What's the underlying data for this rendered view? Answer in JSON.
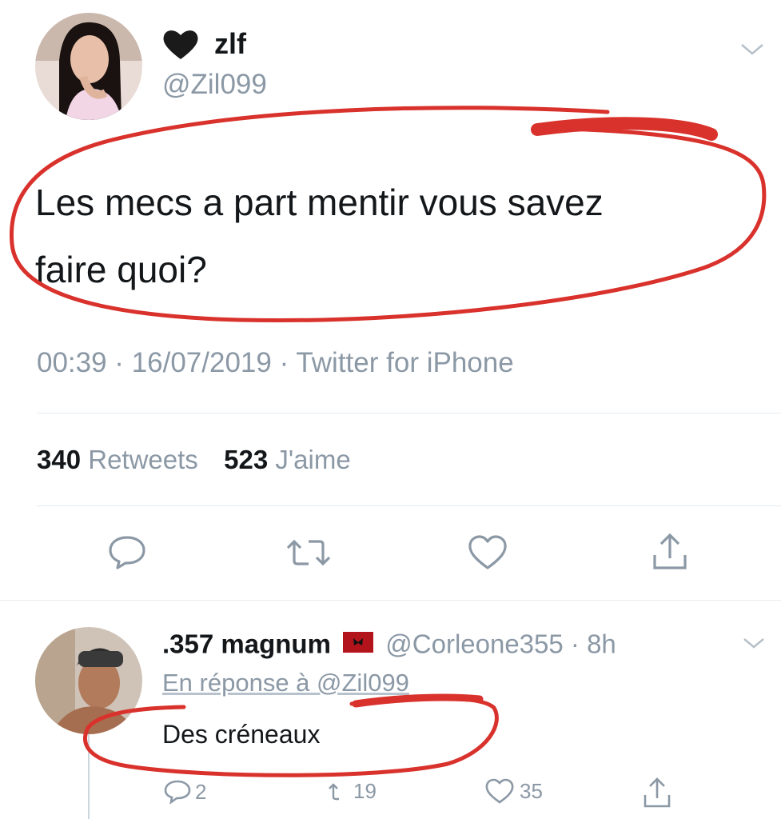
{
  "tweet": {
    "heart_emoji": "🖤",
    "display_name": "zlf",
    "handle": "@Zil099",
    "text_line1": "Les mecs a part mentir vous savez",
    "text_line2": "faire quoi?",
    "meta": "00:39 · 16/07/2019 · Twitter for iPhone",
    "retweets_count": "340",
    "retweets_label": "Retweets",
    "likes_count": "523",
    "likes_label": "J'aime"
  },
  "reply": {
    "display_name": ".357 magnum",
    "handle_time": "@Corleone355 · 8h",
    "in_reply_to": "En réponse à @Zil099",
    "text": "Des créneaux",
    "reply_count": "2",
    "retweet_count": "19",
    "like_count": "35"
  },
  "colors": {
    "annotation_red": "#d9322c",
    "muted_text": "#8b98a5",
    "icon_gray": "#8b98a5",
    "divider": "#e6ecf0"
  },
  "icons": [
    "chevron-down-icon",
    "reply-icon",
    "retweet-icon",
    "like-icon",
    "share-icon",
    "flag-icon"
  ]
}
